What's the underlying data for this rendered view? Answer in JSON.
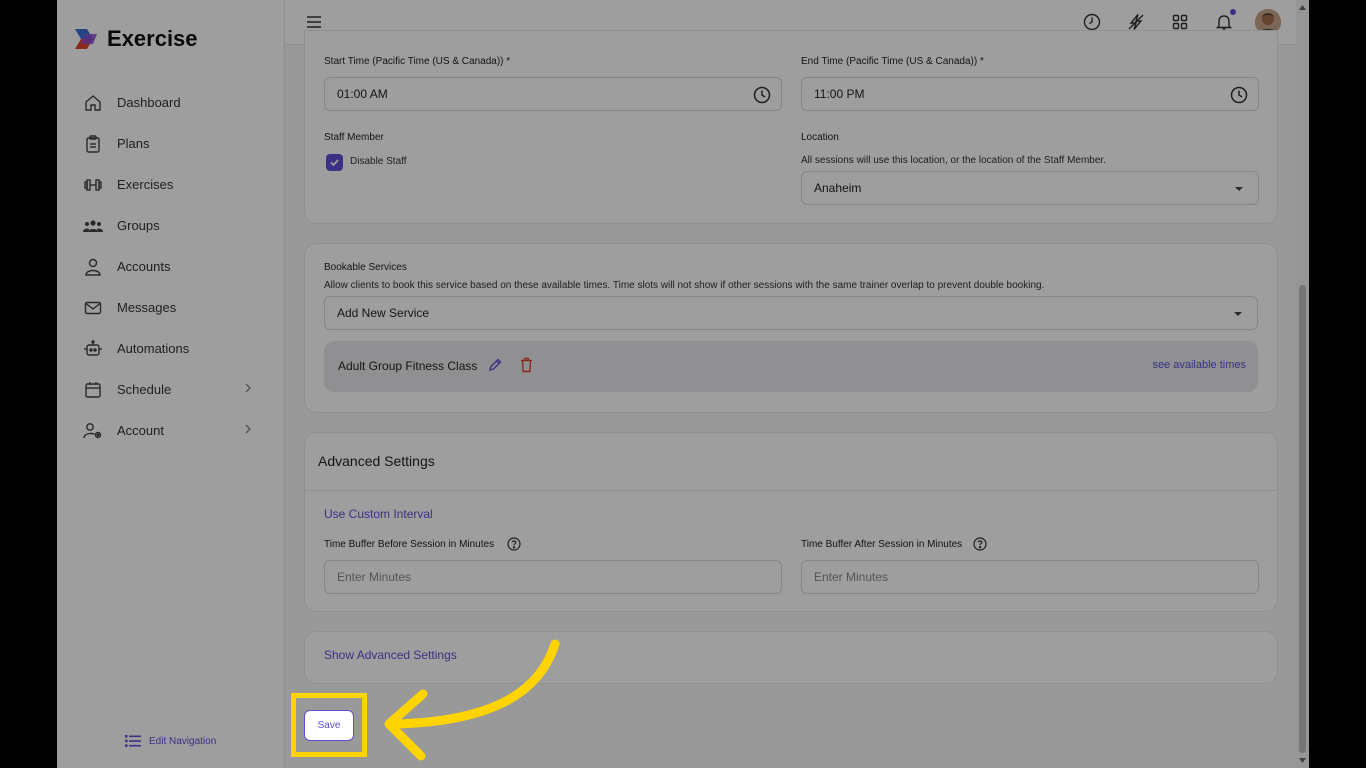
{
  "sidebar": {
    "brand": "Exercise",
    "items": [
      {
        "label": "Dashboard",
        "icon": "home-icon"
      },
      {
        "label": "Plans",
        "icon": "clipboard-icon"
      },
      {
        "label": "Exercises",
        "icon": "dumbbell-icon"
      },
      {
        "label": "Groups",
        "icon": "users-icon"
      },
      {
        "label": "Accounts",
        "icon": "user-icon"
      },
      {
        "label": "Messages",
        "icon": "mail-icon"
      },
      {
        "label": "Automations",
        "icon": "robot-icon"
      },
      {
        "label": "Schedule",
        "icon": "calendar-icon"
      },
      {
        "label": "Account",
        "icon": "user-gear-icon"
      }
    ],
    "edit_navigation": "Edit Navigation"
  },
  "topbar": {
    "icons": [
      "clock-icon",
      "bolt-icon",
      "grid-icon",
      "bell-icon",
      "avatar"
    ]
  },
  "form": {
    "start_time_label": "Start Time (Pacific Time (US & Canada)) *",
    "start_time_value": "01:00 AM",
    "end_time_label": "End Time (Pacific Time (US & Canada)) *",
    "end_time_value": "11:00 PM",
    "staff_member_label": "Staff Member",
    "disable_staff_label": "Disable Staff",
    "disable_staff_checked": true,
    "location_label": "Location",
    "location_help": "All sessions will use this location, or the location of the Staff Member.",
    "location_value": "Anaheim"
  },
  "bookable": {
    "title": "Bookable Services",
    "help": "Allow clients to book this service based on these available times. Time slots will not show if other sessions with the same trainer overlap to prevent double booking.",
    "add_placeholder": "Add New Service",
    "service_name": "Adult Group Fitness Class",
    "see_times": "see available times"
  },
  "advanced": {
    "title": "Advanced Settings",
    "custom_interval": "Use Custom Interval",
    "buffer_before_label": "Time Buffer Before Session in Minutes",
    "buffer_before_placeholder": "Enter Minutes",
    "buffer_after_label": "Time Buffer After Session in Minutes",
    "buffer_after_placeholder": "Enter Minutes",
    "show_advanced": "Show Advanced Settings"
  },
  "actions": {
    "save": "Save"
  },
  "colors": {
    "accent": "#5b4fd6",
    "highlight": "#ffd400",
    "danger": "#e0452b"
  }
}
